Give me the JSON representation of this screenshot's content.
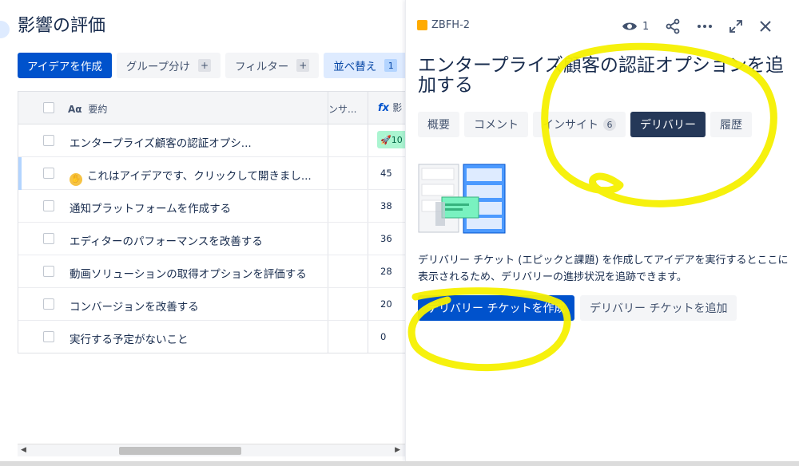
{
  "page": {
    "title": "影響の評価",
    "toolbar": {
      "create_label": "アイデアを作成",
      "group_label": "グループ分け",
      "filter_label": "フィルター",
      "sort_label": "並べ替え",
      "sort_count": "1",
      "plus": "+"
    },
    "table": {
      "col_summary": "要約",
      "col_summary_prefix": "Aα",
      "col_impact": "ンサ...",
      "col_formula_prefix": "fx",
      "col_formula": "影",
      "rows": [
        {
          "summary": "エンタープライズ顧客の認証オプシ...",
          "score": "10"
        },
        {
          "summary": "これはアイデアです、クリックして開きまし...",
          "score": "45"
        },
        {
          "summary": "通知プラットフォームを作成する",
          "score": "38"
        },
        {
          "summary": "エディターのパフォーマンスを改善する",
          "score": "36"
        },
        {
          "summary": "動画ソリューションの取得オプションを評価する",
          "score": "28"
        },
        {
          "summary": "コンバージョンを改善する",
          "score": "20"
        },
        {
          "summary": "実行する予定がないこと",
          "score": "0"
        }
      ]
    }
  },
  "panel": {
    "issue_key": "ZBFH-2",
    "watch_count": "1",
    "title": "エンタープライズ顧客の認証オプションを追加する",
    "tabs": [
      {
        "label": "概要"
      },
      {
        "label": "コメント"
      },
      {
        "label": "インサイト",
        "count": "6"
      },
      {
        "label": "デリバリー"
      },
      {
        "label": "履歴"
      }
    ],
    "description": "デリバリー チケット (エピックと課題) を作成してアイデアを実行するとここに表示されるため、デリバリーの進捗状況を追跡できます。",
    "create_button": "デリバリー チケットを作成",
    "add_button": "デリバリー チケットを追加"
  },
  "colors": {
    "primary": "#0052cc",
    "active_tab": "#253858",
    "marker": "#f5f000"
  }
}
